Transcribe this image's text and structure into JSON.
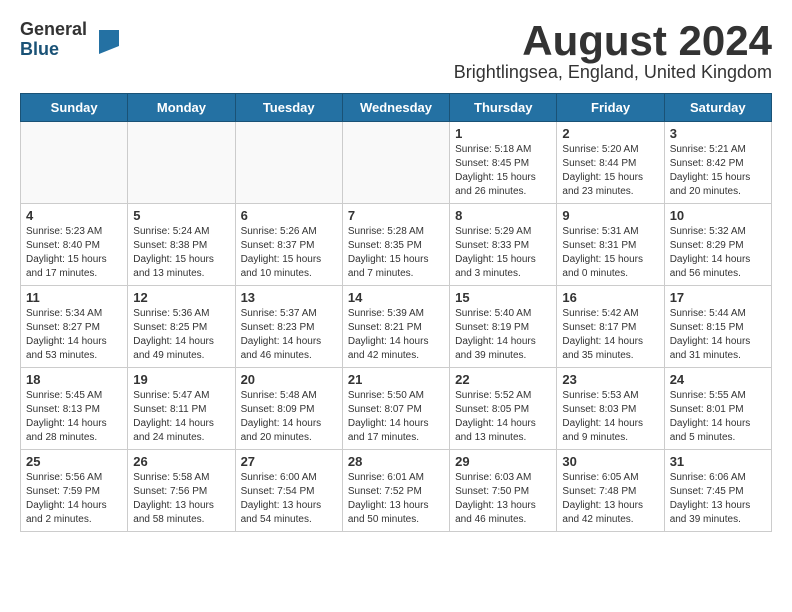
{
  "logo": {
    "general": "General",
    "blue": "Blue"
  },
  "title": {
    "month_year": "August 2024",
    "location": "Brightlingsea, England, United Kingdom"
  },
  "headers": [
    "Sunday",
    "Monday",
    "Tuesday",
    "Wednesday",
    "Thursday",
    "Friday",
    "Saturday"
  ],
  "weeks": [
    [
      {
        "day": "",
        "info": ""
      },
      {
        "day": "",
        "info": ""
      },
      {
        "day": "",
        "info": ""
      },
      {
        "day": "",
        "info": ""
      },
      {
        "day": "1",
        "info": "Sunrise: 5:18 AM\nSunset: 8:45 PM\nDaylight: 15 hours\nand 26 minutes."
      },
      {
        "day": "2",
        "info": "Sunrise: 5:20 AM\nSunset: 8:44 PM\nDaylight: 15 hours\nand 23 minutes."
      },
      {
        "day": "3",
        "info": "Sunrise: 5:21 AM\nSunset: 8:42 PM\nDaylight: 15 hours\nand 20 minutes."
      }
    ],
    [
      {
        "day": "4",
        "info": "Sunrise: 5:23 AM\nSunset: 8:40 PM\nDaylight: 15 hours\nand 17 minutes."
      },
      {
        "day": "5",
        "info": "Sunrise: 5:24 AM\nSunset: 8:38 PM\nDaylight: 15 hours\nand 13 minutes."
      },
      {
        "day": "6",
        "info": "Sunrise: 5:26 AM\nSunset: 8:37 PM\nDaylight: 15 hours\nand 10 minutes."
      },
      {
        "day": "7",
        "info": "Sunrise: 5:28 AM\nSunset: 8:35 PM\nDaylight: 15 hours\nand 7 minutes."
      },
      {
        "day": "8",
        "info": "Sunrise: 5:29 AM\nSunset: 8:33 PM\nDaylight: 15 hours\nand 3 minutes."
      },
      {
        "day": "9",
        "info": "Sunrise: 5:31 AM\nSunset: 8:31 PM\nDaylight: 15 hours\nand 0 minutes."
      },
      {
        "day": "10",
        "info": "Sunrise: 5:32 AM\nSunset: 8:29 PM\nDaylight: 14 hours\nand 56 minutes."
      }
    ],
    [
      {
        "day": "11",
        "info": "Sunrise: 5:34 AM\nSunset: 8:27 PM\nDaylight: 14 hours\nand 53 minutes."
      },
      {
        "day": "12",
        "info": "Sunrise: 5:36 AM\nSunset: 8:25 PM\nDaylight: 14 hours\nand 49 minutes."
      },
      {
        "day": "13",
        "info": "Sunrise: 5:37 AM\nSunset: 8:23 PM\nDaylight: 14 hours\nand 46 minutes."
      },
      {
        "day": "14",
        "info": "Sunrise: 5:39 AM\nSunset: 8:21 PM\nDaylight: 14 hours\nand 42 minutes."
      },
      {
        "day": "15",
        "info": "Sunrise: 5:40 AM\nSunset: 8:19 PM\nDaylight: 14 hours\nand 39 minutes."
      },
      {
        "day": "16",
        "info": "Sunrise: 5:42 AM\nSunset: 8:17 PM\nDaylight: 14 hours\nand 35 minutes."
      },
      {
        "day": "17",
        "info": "Sunrise: 5:44 AM\nSunset: 8:15 PM\nDaylight: 14 hours\nand 31 minutes."
      }
    ],
    [
      {
        "day": "18",
        "info": "Sunrise: 5:45 AM\nSunset: 8:13 PM\nDaylight: 14 hours\nand 28 minutes."
      },
      {
        "day": "19",
        "info": "Sunrise: 5:47 AM\nSunset: 8:11 PM\nDaylight: 14 hours\nand 24 minutes."
      },
      {
        "day": "20",
        "info": "Sunrise: 5:48 AM\nSunset: 8:09 PM\nDaylight: 14 hours\nand 20 minutes."
      },
      {
        "day": "21",
        "info": "Sunrise: 5:50 AM\nSunset: 8:07 PM\nDaylight: 14 hours\nand 17 minutes."
      },
      {
        "day": "22",
        "info": "Sunrise: 5:52 AM\nSunset: 8:05 PM\nDaylight: 14 hours\nand 13 minutes."
      },
      {
        "day": "23",
        "info": "Sunrise: 5:53 AM\nSunset: 8:03 PM\nDaylight: 14 hours\nand 9 minutes."
      },
      {
        "day": "24",
        "info": "Sunrise: 5:55 AM\nSunset: 8:01 PM\nDaylight: 14 hours\nand 5 minutes."
      }
    ],
    [
      {
        "day": "25",
        "info": "Sunrise: 5:56 AM\nSunset: 7:59 PM\nDaylight: 14 hours\nand 2 minutes."
      },
      {
        "day": "26",
        "info": "Sunrise: 5:58 AM\nSunset: 7:56 PM\nDaylight: 13 hours\nand 58 minutes."
      },
      {
        "day": "27",
        "info": "Sunrise: 6:00 AM\nSunset: 7:54 PM\nDaylight: 13 hours\nand 54 minutes."
      },
      {
        "day": "28",
        "info": "Sunrise: 6:01 AM\nSunset: 7:52 PM\nDaylight: 13 hours\nand 50 minutes."
      },
      {
        "day": "29",
        "info": "Sunrise: 6:03 AM\nSunset: 7:50 PM\nDaylight: 13 hours\nand 46 minutes."
      },
      {
        "day": "30",
        "info": "Sunrise: 6:05 AM\nSunset: 7:48 PM\nDaylight: 13 hours\nand 42 minutes."
      },
      {
        "day": "31",
        "info": "Sunrise: 6:06 AM\nSunset: 7:45 PM\nDaylight: 13 hours\nand 39 minutes."
      }
    ]
  ]
}
